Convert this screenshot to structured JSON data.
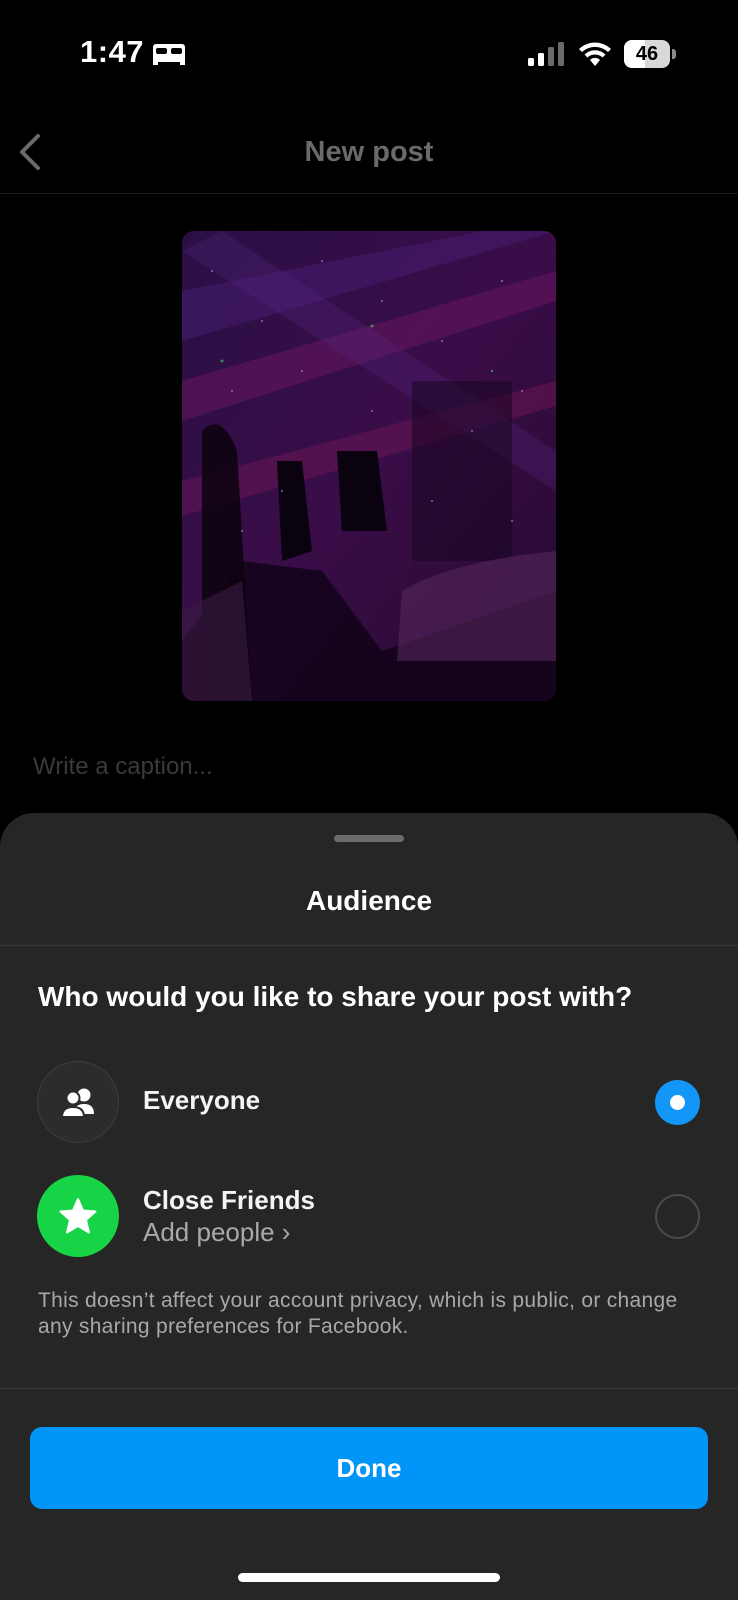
{
  "status_bar": {
    "time": "1:47",
    "battery": "46",
    "battery_level": 0.46,
    "icons": [
      "bed-icon",
      "signal-icon",
      "wifi-icon",
      "battery-icon"
    ]
  },
  "header": {
    "title": "New post",
    "back_icon": "chevron-left-icon"
  },
  "post": {
    "caption_placeholder": "Write a caption..."
  },
  "sheet": {
    "title": "Audience",
    "question": "Who would you like to share your post with?",
    "options": [
      {
        "label": "Everyone",
        "icon": "people-icon",
        "selected": true
      },
      {
        "label": "Close Friends",
        "sublabel": "Add people ›",
        "icon": "star-icon",
        "selected": false
      }
    ],
    "disclaimer": "This doesn’t affect your account privacy, which is public, or change any sharing preferences for Facebook.",
    "done_label": "Done"
  },
  "colors": {
    "accent": "#0095f6",
    "radio_selected": "#1296f8",
    "close_friends": "#17d346",
    "sheet_bg": "#262626"
  }
}
